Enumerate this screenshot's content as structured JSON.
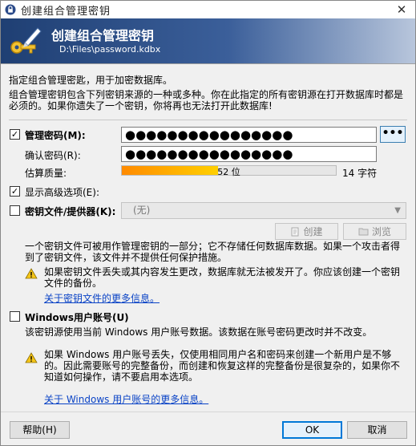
{
  "window": {
    "title": "创建组合管理密钥",
    "close_glyph": "✕"
  },
  "banner": {
    "title": "创建组合管理密钥",
    "file_path": "D:\\Files\\password.kdbx"
  },
  "intro": {
    "line1": "指定组合管理密匙，用于加密数据库。",
    "line2": "组合管理密钥包含下列密钥来源的一种或多种。你在此指定的所有密钥源在打开数据库时都是必须的。如果你遗失了一个密钥，你将再也无法打开此数据库!"
  },
  "master_password": {
    "checked": true,
    "label": "管理密码(M):",
    "value": "●●●●●●●●●●●●●●●●",
    "show_button": "•••",
    "confirm_label": "确认密码(R):",
    "confirm_value": "●●●●●●●●●●●●●●●●",
    "quality_label": "估算质量:",
    "quality_bits": "52 位",
    "quality_fraction": 0.45,
    "char_count": "14 字符"
  },
  "advanced": {
    "checked": true,
    "label": "显示高级选项(E):"
  },
  "key_file": {
    "checked": false,
    "label": "密钥文件/提供器(K):",
    "select_value": "(无)",
    "create_button": "创建",
    "browse_button": "浏览",
    "description": "一个密钥文件可被用作管理密钥的一部分；它不存储任何数据库数据。如果一个攻击者得到了密钥文件，该文件并不提供任何保护措施。",
    "warning": "如果密钥文件丢失或其内容发生更改，数据库就无法被发开了。你应该创建一个密钥文件的备份。",
    "more_info_link": "关于密钥文件的更多信息。"
  },
  "windows_account": {
    "checked": false,
    "label": "Windows用户账号(U)",
    "description": "该密钥源使用当前 Windows 用户账号数据。该数据在账号密码更改时并不改变。",
    "warning": "如果 Windows 用户账号丢失，仅使用相同用户名和密码来创建一个新用户是不够的。因此需要账号的完整备份，而创建和恢复这样的完整备份是很复杂的，如果你不知道如何操作，请不要启用本选项。",
    "more_info_link": "关于 Windows 用户账号的更多信息。"
  },
  "footer": {
    "help_button": "帮助(H)",
    "ok_button": "OK",
    "cancel_button": "取消"
  }
}
